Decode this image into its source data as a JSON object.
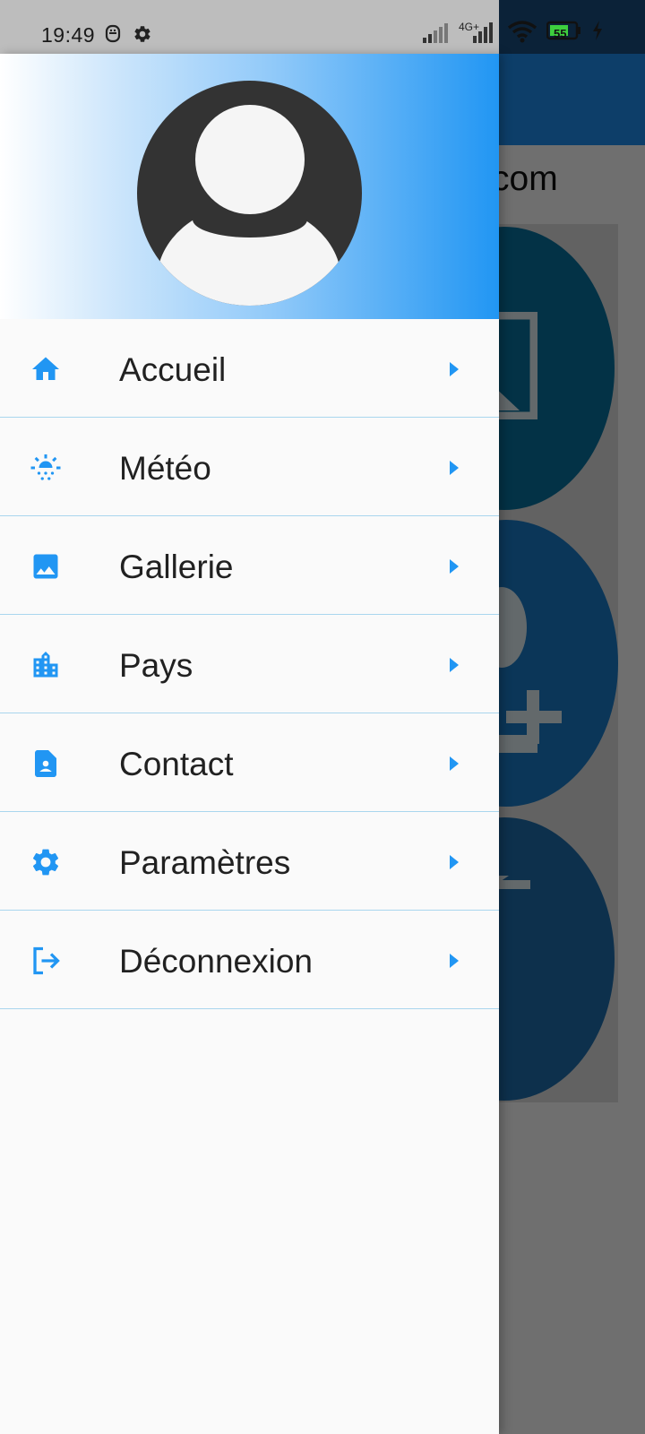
{
  "status_bar": {
    "time": "19:49",
    "network_label": "4G+",
    "battery_level": "55",
    "icons": [
      "notification-app-icon",
      "settings-gear-icon",
      "signal-icon",
      "4g-signal-icon",
      "wifi-icon",
      "battery-icon",
      "charging-bolt-icon"
    ]
  },
  "background": {
    "partial_text": "com"
  },
  "drawer": {
    "header": {
      "avatar_icon": "account-circle-icon",
      "gradient": [
        "#ffffff",
        "#2196f3"
      ]
    },
    "items": [
      {
        "label": "Accueil",
        "icon": "home-icon"
      },
      {
        "label": "Météo",
        "icon": "weather-sunny-icon"
      },
      {
        "label": "Gallerie",
        "icon": "image-icon"
      },
      {
        "label": "Pays",
        "icon": "location-city-icon"
      },
      {
        "label": "Contact",
        "icon": "contact-page-icon"
      },
      {
        "label": "Paramètres",
        "icon": "settings-icon"
      },
      {
        "label": "Déconnexion",
        "icon": "logout-icon"
      }
    ],
    "chevron_icon": "arrow-right-icon"
  },
  "colors": {
    "accent": "#2196f3",
    "divider": "#a9d6ee",
    "drawer_bg": "#fafafa",
    "text": "#212121"
  }
}
